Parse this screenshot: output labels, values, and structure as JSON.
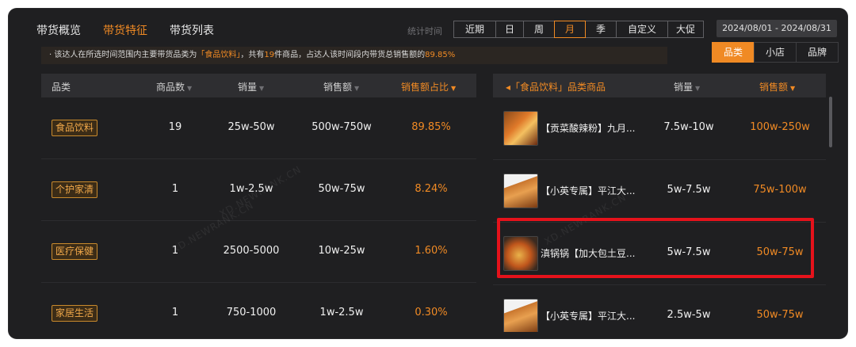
{
  "nav": {
    "tabs": [
      "带货概览",
      "带货特征",
      "带货列表"
    ],
    "active_index": 1
  },
  "filters": {
    "stat_label": "统计时间",
    "periods": [
      "近期",
      "日",
      "周",
      "月",
      "季",
      "自定义",
      "大促"
    ],
    "active_period": "月",
    "date_range": "2024/08/01 - 2024/08/31"
  },
  "notice": {
    "prefix": "· 该达人在所选时间范围内主要带货品类为",
    "category": "「食品饮料」",
    "mid1": "，共有",
    "count": "19",
    "mid2": "件商品，占达人该时间段内带货总销售额的",
    "percent": "89.85%"
  },
  "view_toggle": {
    "options": [
      "品类",
      "小店",
      "品牌"
    ],
    "active": "品类"
  },
  "left_table": {
    "headers": [
      "品类",
      "商品数",
      "销量",
      "销售额",
      "销售额占比"
    ],
    "rows": [
      {
        "category": "食品饮料",
        "count": "19",
        "volume": "25w-50w",
        "sales": "500w-750w",
        "share": "89.85%"
      },
      {
        "category": "个护家清",
        "count": "1",
        "volume": "1w-2.5w",
        "sales": "50w-75w",
        "share": "8.24%"
      },
      {
        "category": "医疗保健",
        "count": "1",
        "volume": "2500-5000",
        "sales": "10w-25w",
        "share": "1.60%"
      },
      {
        "category": "家居生活",
        "count": "1",
        "volume": "750-1000",
        "sales": "1w-2.5w",
        "share": "0.30%"
      }
    ]
  },
  "right_table": {
    "header_title": "◂「食品饮料」品类商品",
    "headers": [
      "销量",
      "销售额"
    ],
    "rows": [
      {
        "name": "【贡菜酸辣粉】九月...",
        "volume": "7.5w-10w",
        "sales": "100w-250w"
      },
      {
        "name": "【小英专属】平江大...",
        "volume": "5w-7.5w",
        "sales": "75w-100w"
      },
      {
        "name": "滇锅锅【加大包土豆...",
        "volume": "5w-7.5w",
        "sales": "50w-75w"
      },
      {
        "name": "【小英专属】平江大...",
        "volume": "2.5w-5w",
        "sales": "50w-75w"
      }
    ]
  },
  "watermark": "XD.NEWRANK.CN",
  "colors": {
    "accent": "#f08a24",
    "background": "#1f1f21",
    "highlight_box": "#e5121b"
  }
}
